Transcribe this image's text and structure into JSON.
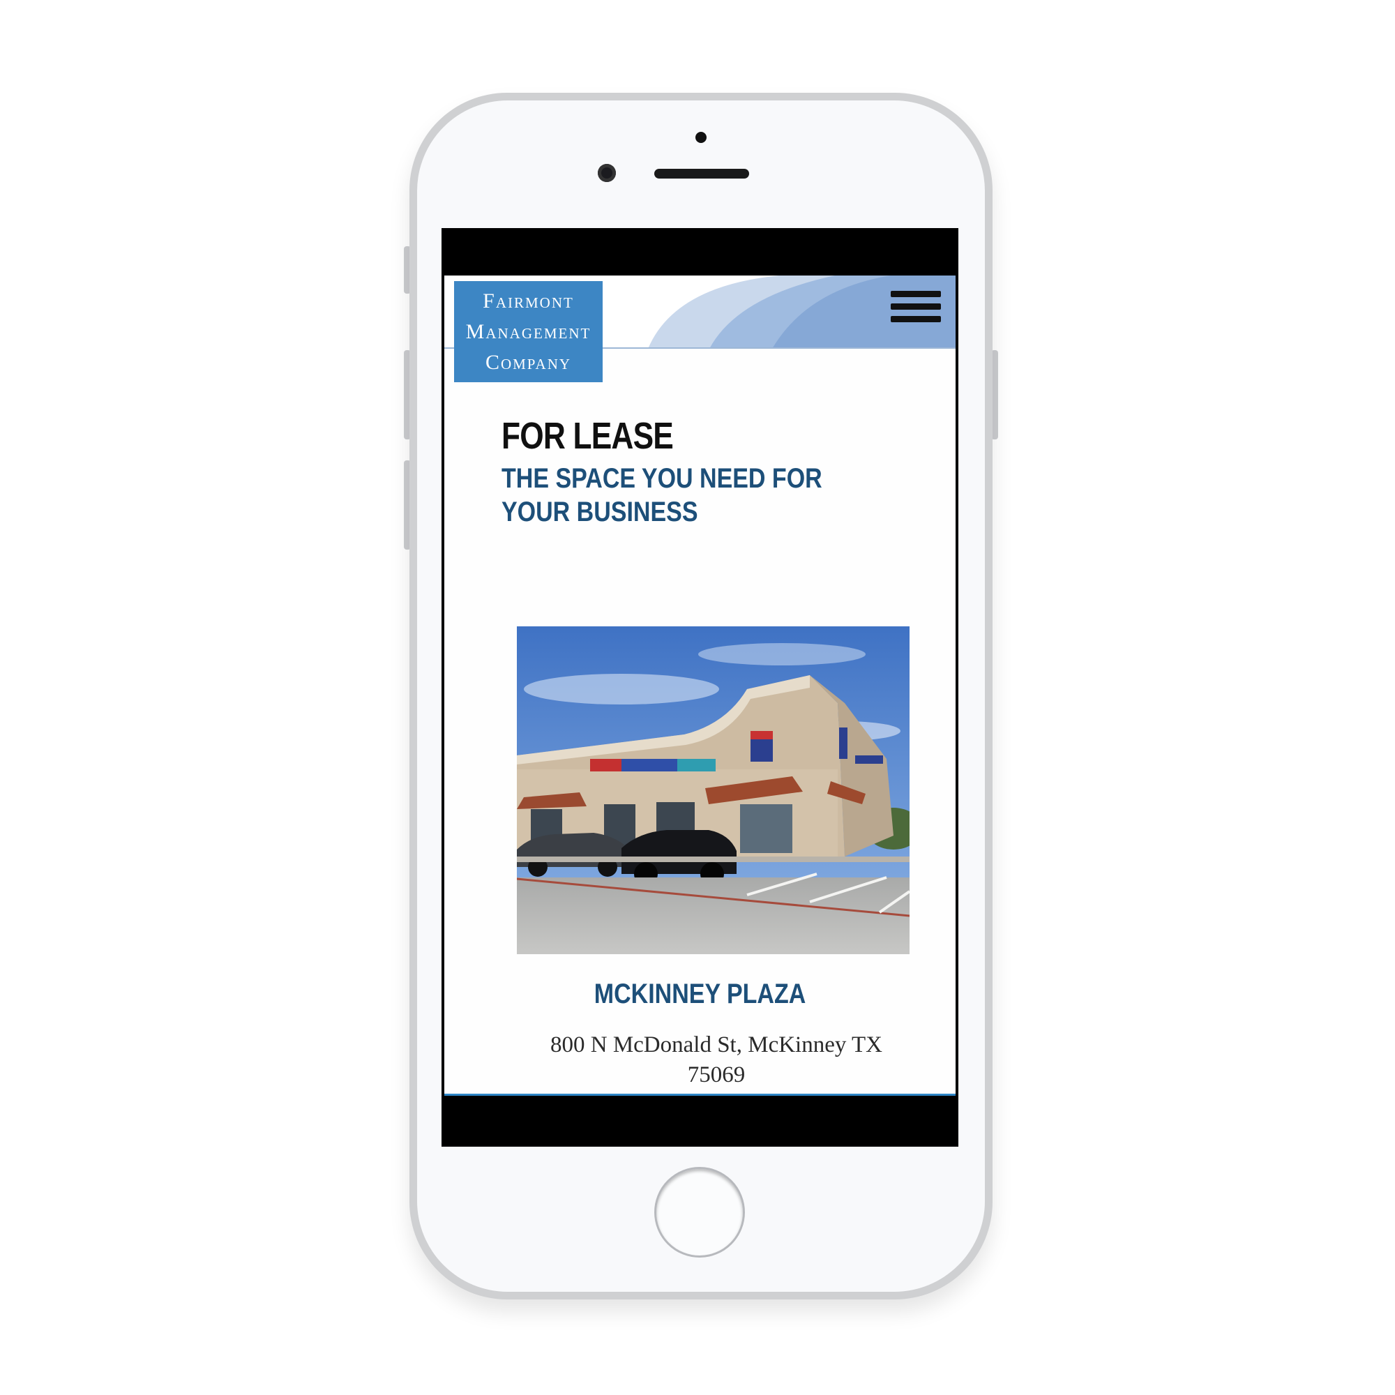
{
  "logo": {
    "line1": "Fairmont",
    "line2": "Management",
    "line3": "Company"
  },
  "icons": {
    "menu": "hamburger-menu-icon"
  },
  "hero": {
    "title": "FOR LEASE",
    "subtitle": "THE SPACE YOU NEED FOR YOUR BUSINESS"
  },
  "property": {
    "name": "MCKINNEY PLAZA",
    "address": "800 N McDonald St, McKinney TX 75069"
  },
  "colors": {
    "brand_blue": "#3d86c4",
    "heading_navy": "#1d4f79",
    "header_swoosh": "#8aaedb"
  }
}
